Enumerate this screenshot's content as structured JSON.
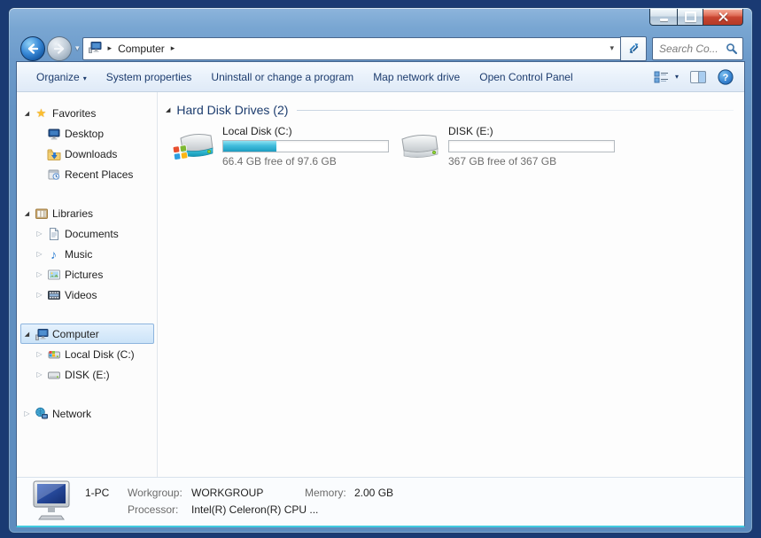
{
  "window": {
    "controls": [
      {
        "name": "minimize"
      },
      {
        "name": "maximize"
      },
      {
        "name": "close"
      }
    ]
  },
  "navigation": {
    "breadcrumb": {
      "root_icon": "computer-icon",
      "items": [
        {
          "label": "Computer"
        }
      ]
    },
    "search": {
      "placeholder": "Search Co..."
    }
  },
  "toolbar": {
    "organize": {
      "label": "Organize"
    },
    "items": [
      {
        "label": "System properties"
      },
      {
        "label": "Uninstall or change a program"
      },
      {
        "label": "Map network drive"
      },
      {
        "label": "Open Control Panel"
      }
    ],
    "right_icons": [
      {
        "name": "views-icon"
      },
      {
        "name": "preview-pane-icon"
      },
      {
        "name": "help-icon"
      }
    ]
  },
  "sidebar": {
    "items": [
      {
        "label": "Favorites",
        "icon": "favorites-star-icon",
        "expander": "expanded",
        "level": 0
      },
      {
        "label": "Desktop",
        "icon": "desktop-icon",
        "expander": "none",
        "level": 1
      },
      {
        "label": "Downloads",
        "icon": "downloads-icon",
        "expander": "none",
        "level": 1
      },
      {
        "label": "Recent Places",
        "icon": "recent-places-icon",
        "expander": "none",
        "level": 1
      },
      {
        "label": "Libraries",
        "icon": "libraries-icon",
        "expander": "expanded",
        "level": 0
      },
      {
        "label": "Documents",
        "icon": "documents-icon",
        "expander": "collapsed",
        "level": 1
      },
      {
        "label": "Music",
        "icon": "music-icon",
        "expander": "collapsed",
        "level": 1
      },
      {
        "label": "Pictures",
        "icon": "pictures-icon",
        "expander": "collapsed",
        "level": 1
      },
      {
        "label": "Videos",
        "icon": "videos-icon",
        "expander": "collapsed",
        "level": 1
      },
      {
        "label": "Computer",
        "icon": "computer-icon",
        "expander": "expanded",
        "level": 0,
        "selected": true
      },
      {
        "label": "Local Disk (C:)",
        "icon": "local-disk-icon",
        "expander": "collapsed",
        "level": 1
      },
      {
        "label": "DISK (E:)",
        "icon": "disk-icon",
        "expander": "collapsed",
        "level": 1
      },
      {
        "label": "Network",
        "icon": "network-icon",
        "expander": "collapsed",
        "level": 0
      }
    ]
  },
  "main": {
    "group": {
      "label": "Hard Disk Drives (2)",
      "expander": "expanded"
    },
    "drives": [
      {
        "name": "Local Disk (C:)",
        "free_text": "66.4 GB free of 97.6 GB",
        "used_percent": 32,
        "bar_fill": "32%",
        "icon": "hard-drive-windows-icon"
      },
      {
        "name": "DISK (E:)",
        "free_text": "367 GB free of 367 GB",
        "used_percent": 0,
        "bar_fill": "0%",
        "icon": "hard-drive-icon"
      }
    ]
  },
  "details": {
    "computer_name": "1-PC",
    "workgroup_label": "Workgroup:",
    "workgroup_value": "WORKGROUP",
    "memory_label": "Memory:",
    "memory_value": "2.00 GB",
    "processor_label": "Processor:",
    "processor_value": "Intel(R) Celeron(R) CPU ..."
  },
  "icons": {
    "star": "★",
    "music_note": "♪",
    "expander_expanded": "◢",
    "expander_collapsed": "▷",
    "breadcrumb_separator": "▸",
    "dropdown_caret": "▾",
    "help_glyph": "?"
  },
  "colors": {
    "capacity_fill": "#2fb1d4",
    "selection": "#cbe3f8",
    "frame_blue": "#6392c3",
    "close_red": "#c84531",
    "surround": "#1a3a73"
  }
}
